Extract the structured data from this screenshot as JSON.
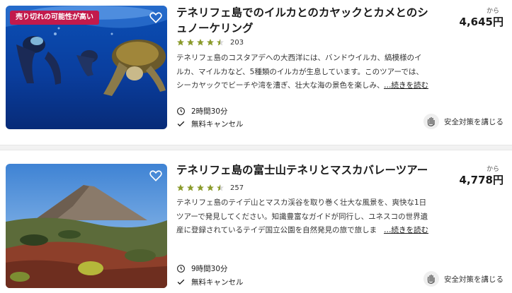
{
  "cards": [
    {
      "badge": "売り切れの可能性が高い",
      "title": "テネリフェ島でのイルカとのカヤックとカメとのシュノーケリング",
      "rating": 4.5,
      "review_count": "203",
      "description": "テネリフェ島のコスタアデへの大西洋には、バンドウイルカ、縞模様のイルカ、マイルカなど、5種類のイルカが生息しています。このツアーでは、シーカヤックでビーチや湾を漕ぎ、壮大な海の景色を楽しみ、",
      "read_more": "…続きを読む",
      "duration": "2時間30分",
      "cancel": "無料キャンセル",
      "from_label": "から",
      "price": "4,645円",
      "safety": "安全対策を講じる"
    },
    {
      "title": "テネリフェ島の富士山テネリとマスカバレーツアー",
      "rating": 4.5,
      "review_count": "257",
      "description": "テネリフェ島のテイデ山とマスカ渓谷を取り巻く壮大な風景を、爽快な1日ツアーで発見してください。知識豊富なガイドが同行し、ユネスコの世界遺産に登録されているテイデ国立公園を自然発見の旅で旅しま",
      "read_more": "…続きを読む",
      "duration": "9時間30分",
      "cancel": "無料キャンセル",
      "from_label": "から",
      "price": "4,778円",
      "safety": "安全対策を講じる"
    }
  ],
  "colors": {
    "badge": "#c21a4c",
    "stars": "#8a9a2a",
    "text": "#1a1a1a"
  },
  "icons": [
    "heart-icon",
    "star-icon",
    "clock-icon",
    "check-icon",
    "safety-hand-icon"
  ]
}
